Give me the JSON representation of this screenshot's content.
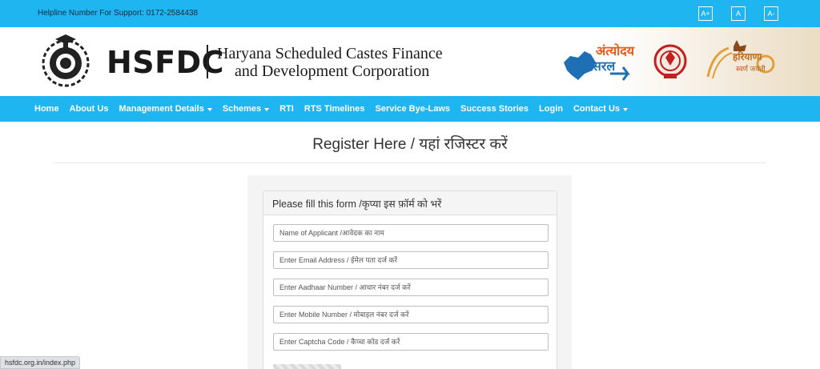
{
  "topbar": {
    "helpline": "Helpline Number For Support: 0172-2584438",
    "font_buttons": [
      "A+",
      "A",
      "A-"
    ]
  },
  "header": {
    "brand": "HSFDC",
    "org_line1": "Haryana Scheduled Castes Finance",
    "org_line2": "and Development Corporation",
    "antyodaya_line1": "अंत्योदय",
    "antyodaya_line2": "सरल",
    "swarn_line1": "हरियाणा",
    "swarn_line2": "स्वर्ण जयंती"
  },
  "nav": {
    "items": [
      {
        "label": "Home",
        "dropdown": false
      },
      {
        "label": "About Us",
        "dropdown": false
      },
      {
        "label": "Management Details",
        "dropdown": true
      },
      {
        "label": "Schemes",
        "dropdown": true
      },
      {
        "label": "RTI",
        "dropdown": false
      },
      {
        "label": "RTS Timelines",
        "dropdown": false
      },
      {
        "label": "Service Bye-Laws",
        "dropdown": false
      },
      {
        "label": "Success Stories",
        "dropdown": false
      },
      {
        "label": "Login",
        "dropdown": false
      },
      {
        "label": "Contact Us",
        "dropdown": true
      }
    ]
  },
  "main": {
    "title": "Register Here / यहां रजिस्टर करें",
    "form_heading": "Please fill this form /कृप्या इस फ़ॉर्म को भरें",
    "fields": [
      {
        "placeholder": "Name of Applicant /आवेदक का नाम"
      },
      {
        "placeholder": "Enter Email Address / ईमेल पता दर्ज करें"
      },
      {
        "placeholder": "Enter Aadhaar Number / आधार नंबर दर्ज करें"
      },
      {
        "placeholder": "Enter Mobile Number / मोबाइल नंबर दर्ज करें"
      },
      {
        "placeholder": "Enter Captcha Code / कैप्चा कोड दर्ज करें"
      }
    ]
  },
  "statusbar": {
    "url": "hsfdc.org.in/index.php"
  },
  "colors": {
    "accent": "#1fb5f0",
    "text": "#333333"
  }
}
